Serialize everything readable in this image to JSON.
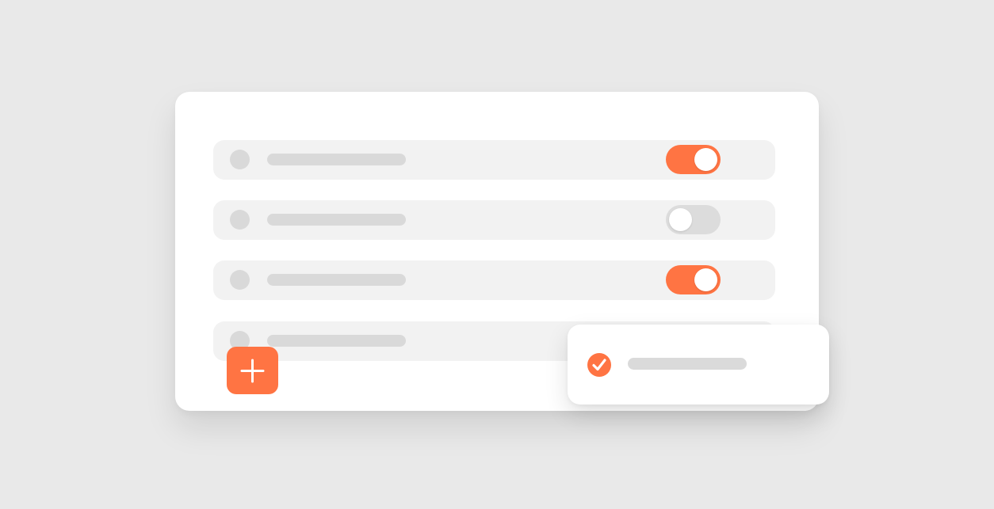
{
  "colors": {
    "accent": "#ff7443",
    "background": "#e9e9e9",
    "card": "#ffffff",
    "row": "#f2f2f2",
    "placeholder": "#d9d9d9",
    "toggle_off": "#dcdcdc"
  },
  "list": {
    "rows": [
      {
        "toggle": "on"
      },
      {
        "toggle": "off"
      },
      {
        "toggle": "on"
      },
      {
        "toggle": null
      }
    ]
  },
  "add_button": {
    "icon": "plus-icon"
  },
  "popup": {
    "icon": "check-circle-icon"
  }
}
